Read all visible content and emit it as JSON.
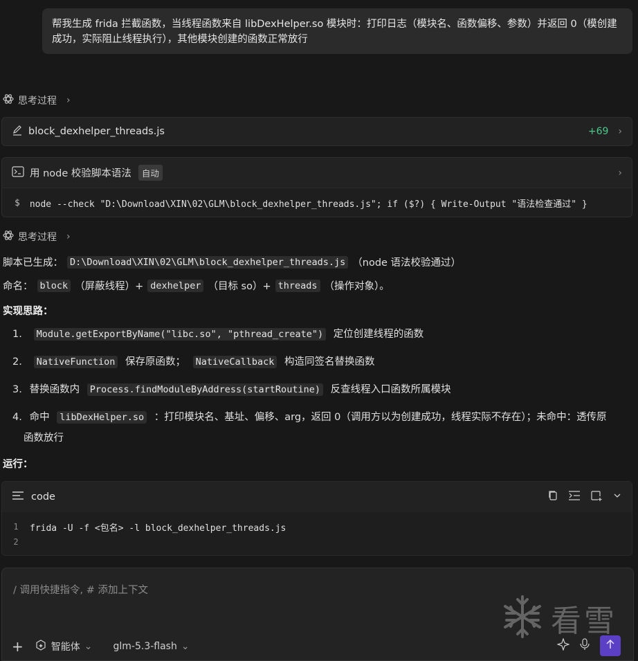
{
  "user_message": "帮我生成 frida 拦截函数，当线程函数来自 libDexHelper.so 模块时：打印日志（模块名、函数偏移、参数）并返回 0（模创建成功，实际阻止线程执行），其他模块创建的函数正常放行",
  "thinking_label": "思考过程",
  "file_card": {
    "filename": "block_dexhelper_threads.js",
    "delta": "+69"
  },
  "command_card": {
    "title": "用 node 校验脚本语法",
    "badge": "自动",
    "prompt": "$",
    "command": "node --check \"D:\\Download\\XIN\\02\\GLM\\block_dexhelper_threads.js\"; if ($?) { Write-Output \"语法检查通过\" }"
  },
  "answer": {
    "generated_prefix": "脚本已生成：",
    "generated_path": "D:\\Download\\XIN\\02\\GLM\\block_dexhelper_threads.js",
    "generated_suffix": "（node 语法校验通过）",
    "naming_prefix": "命名：",
    "naming_parts": [
      {
        "code": "block",
        "text": "（屏蔽线程）+"
      },
      {
        "code": "dexhelper",
        "text": "（目标 so）+"
      },
      {
        "code": "threads",
        "text": "（操作对象）。"
      }
    ],
    "approach_heading": "实现思路：",
    "steps": [
      {
        "num": "1.",
        "pre": "",
        "code1": "Module.getExportByName(\"libc.so\", \"pthread_create\")",
        "mid": "定位创建线程的函数",
        "code2": "",
        "post": ""
      },
      {
        "num": "2.",
        "pre": "",
        "code1": "NativeFunction",
        "mid": "保存原函数；",
        "code2": "NativeCallback",
        "post": "构造同签名替换函数"
      },
      {
        "num": "3.",
        "pre": "替换函数内",
        "code1": "Process.findModuleByAddress(startRoutine)",
        "mid": "反查线程入口函数所属模块",
        "code2": "",
        "post": ""
      },
      {
        "num": "4.",
        "pre": "命中",
        "code1": "libDexHelper.so",
        "mid": "：打印模块名、基址、偏移、arg，返回 0（调用方以为创建成功，线程实际不存在）；未命中：透传原",
        "code2": "",
        "post": "函数放行"
      }
    ],
    "run_heading": "运行："
  },
  "code_block": {
    "lang": "code",
    "lines": [
      {
        "n": "1",
        "text": "frida -U -f <包名> -l block_dexhelper_threads.js"
      },
      {
        "n": "2",
        "text": ""
      }
    ]
  },
  "input": {
    "placeholder": "/ 调用快捷指令, # 添加上下文",
    "agent_label": "智能体",
    "model_label": "glm-5.3-flash"
  },
  "watermark": "看雪",
  "colors": {
    "accent": "#5b3fc4",
    "delta_green": "#4ec98b",
    "background": "#181818"
  }
}
